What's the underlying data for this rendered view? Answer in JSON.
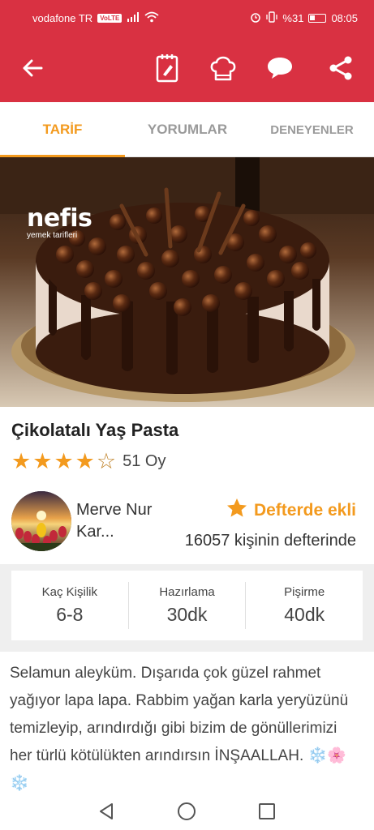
{
  "status_bar": {
    "carrier": "vodafone TR",
    "network_badge": "VoLTE",
    "battery": "%31",
    "time": "08:05"
  },
  "app_bar": {
    "icons": [
      "back-arrow-icon",
      "notebook-icon",
      "chef-hat-icon",
      "comment-icon",
      "share-icon"
    ]
  },
  "tabs": [
    {
      "label": "TARİF",
      "active": true
    },
    {
      "label": "YORUMLAR",
      "active": false
    },
    {
      "label": "DENEYENLER",
      "active": false
    }
  ],
  "hero": {
    "logo_name": "nefis",
    "logo_sub": "yemek tarifleri"
  },
  "recipe": {
    "title": "Çikolatalı Yaş Pasta",
    "rating": 4,
    "rating_max": 5,
    "votes": "51 Oy"
  },
  "author": {
    "name": "Merve Nur Kar..."
  },
  "notebook": {
    "status": "Defterde ekli",
    "count_text": "16057 kişinin defterinde"
  },
  "info": [
    {
      "label": "Kaç Kişilik",
      "value": "6-8"
    },
    {
      "label": "Hazırlama",
      "value": "30dk"
    },
    {
      "label": "Pişirme",
      "value": "40dk"
    }
  ],
  "description": "Selamun aleyküm. Dışarıda çok güzel rahmet yağıyor lapa lapa. Rabbim yağan karla yeryüzünü temizleyip, arındırdığı gibi bizim de gönüllerimizi her türlü kötülükten arındırsın İNŞAALLAH. ❄️🌸❄️",
  "colors": {
    "brand_red": "#d93142",
    "accent_orange": "#f39a1e"
  },
  "nav_bar": {
    "icons": [
      "back-triangle-icon",
      "home-circle-icon",
      "recents-square-icon"
    ]
  }
}
